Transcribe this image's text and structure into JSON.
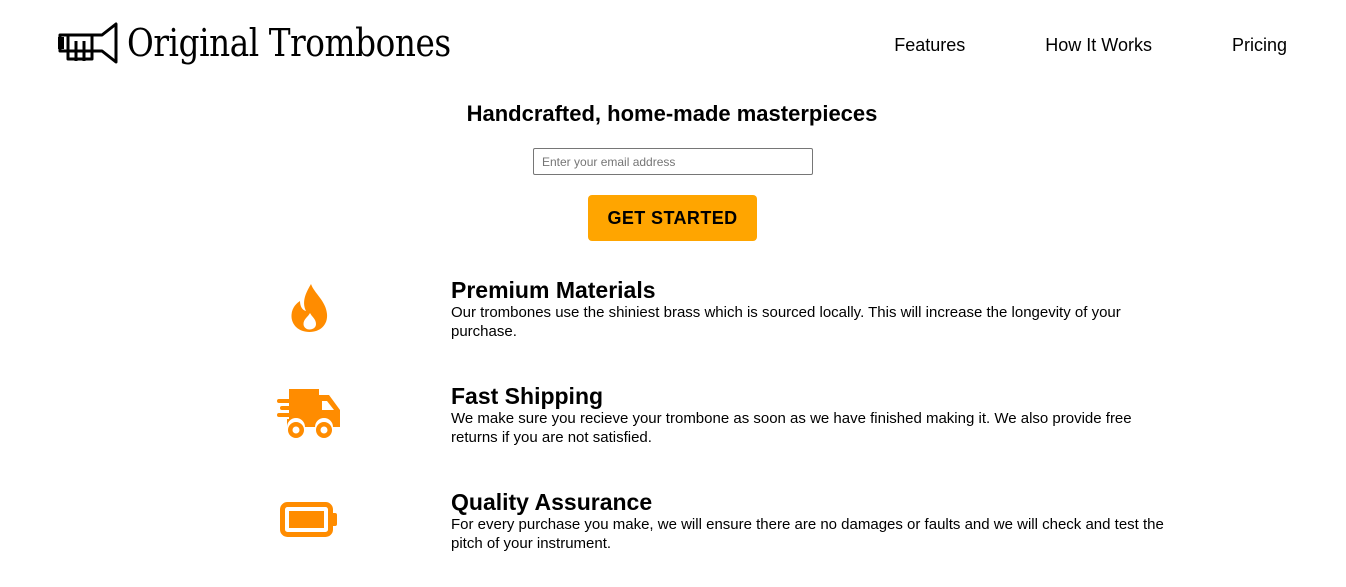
{
  "header": {
    "brand": "Original Trombones",
    "logo_icon": "trumpet-icon",
    "nav": [
      {
        "label": "Features"
      },
      {
        "label": "How It Works"
      },
      {
        "label": "Pricing"
      }
    ]
  },
  "hero": {
    "title": "Handcrafted, home-made masterpieces",
    "email_placeholder": "Enter your email address",
    "cta_label": "GET STARTED"
  },
  "features": [
    {
      "icon": "fire-icon",
      "title": "Premium Materials",
      "text": "Our trombones use the shiniest brass which is sourced locally. This will increase the longevity of your purchase."
    },
    {
      "icon": "shipping-truck-icon",
      "title": "Fast Shipping",
      "text": "We make sure you recieve your trombone as soon as we have finished making it. We also provide free returns if you are not satisfied."
    },
    {
      "icon": "battery-full-icon",
      "title": "Quality Assurance",
      "text": "For every purchase you make, we will ensure there are no damages or faults and we will check and test the pitch of your instrument."
    }
  ],
  "colors": {
    "accent": "#ffa500",
    "icon": "#ff8c00"
  }
}
